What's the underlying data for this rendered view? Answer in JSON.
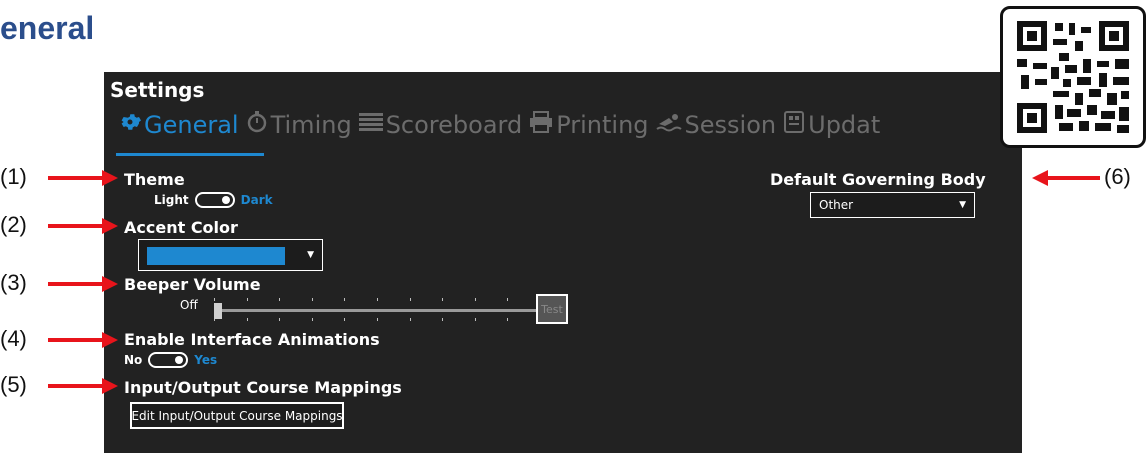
{
  "page_heading": "eneral",
  "window": {
    "title": "Settings",
    "tabs": [
      {
        "label": "General",
        "icon": "gear-icon",
        "active": true
      },
      {
        "label": "Timing",
        "icon": "stopwatch-icon",
        "active": false
      },
      {
        "label": "Scoreboard",
        "icon": "scoreboard-icon",
        "active": false
      },
      {
        "label": "Printing",
        "icon": "printer-icon",
        "active": false
      },
      {
        "label": "Session",
        "icon": "swimmer-icon",
        "active": false
      },
      {
        "label": "Updat",
        "icon": "update-icon",
        "active": false
      }
    ]
  },
  "theme": {
    "label": "Theme",
    "off_text": "Light",
    "on_text": "Dark",
    "value": "Dark"
  },
  "accent_color": {
    "label": "Accent Color",
    "value": "#1e88d0"
  },
  "beeper_volume": {
    "label": "Beeper Volume",
    "min_label": "Off",
    "value": 0,
    "test_label": "Test"
  },
  "animations": {
    "label": "Enable Interface Animations",
    "off_text": "No",
    "on_text": "Yes",
    "value": "Yes"
  },
  "course_mappings": {
    "label": "Input/Output Course Mappings",
    "button_label": "Edit Input/Output Course Mappings"
  },
  "governing_body": {
    "label": "Default Governing Body",
    "selected": "Other"
  },
  "callouts": [
    "(1)",
    "(2)",
    "(3)",
    "(4)",
    "(5)",
    "(6)"
  ],
  "colors": {
    "accent": "#1e88d0",
    "window_bg": "#222222",
    "heading": "#2b4e8c",
    "arrow": "#e8141b"
  }
}
